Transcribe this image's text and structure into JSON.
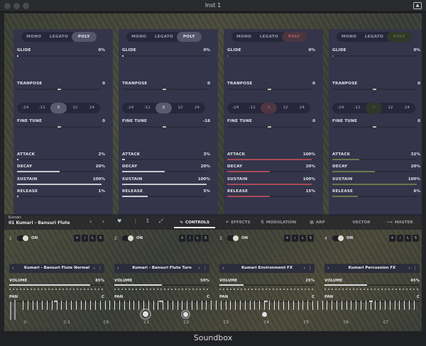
{
  "window": {
    "title": "Inst 1",
    "colors": {
      "panel": "#34354a",
      "accent_red": "#a84a55",
      "accent_green": "#6a7a4a"
    }
  },
  "panels": [
    {
      "modes": [
        "MONO",
        "LEGATO",
        "POLY"
      ],
      "active_mode": 2,
      "glide": {
        "label": "GLIDE",
        "value": "0%",
        "level": 0
      },
      "transpose": {
        "label": "TRANPOSE",
        "value": "0"
      },
      "semitones": [
        "-24",
        "-12",
        "0",
        "12",
        "24"
      ],
      "active_semitone": 2,
      "fine_tune": {
        "label": "FINE TUNE",
        "value": "0"
      },
      "attack": {
        "label": "ATTACK",
        "value": "2%",
        "level": 0.02
      },
      "decay": {
        "label": "DECAY",
        "value": "20%",
        "level": 0.5
      },
      "sustain": {
        "label": "SUSTAIN",
        "value": "100%",
        "level": 1.0
      },
      "release": {
        "label": "RELEASE",
        "value": "1%",
        "level": 0.01
      }
    },
    {
      "modes": [
        "MONO",
        "LEGATO",
        "POLY"
      ],
      "active_mode": 2,
      "glide": {
        "label": "GLIDE",
        "value": "0%",
        "level": 0
      },
      "transpose": {
        "label": "TRANPOSE",
        "value": "0"
      },
      "semitones": [
        "-24",
        "-12",
        "0",
        "12",
        "24"
      ],
      "active_semitone": 2,
      "fine_tune": {
        "label": "FINE TUNE",
        "value": "-18"
      },
      "attack": {
        "label": "ATTACK",
        "value": "3%",
        "level": 0.03
      },
      "decay": {
        "label": "DECAY",
        "value": "20%",
        "level": 0.5
      },
      "sustain": {
        "label": "SUSTAIN",
        "value": "100%",
        "level": 1.0
      },
      "release": {
        "label": "RELEASE",
        "value": "5%",
        "level": 0.3
      }
    },
    {
      "modes": [
        "MONO",
        "LEGATO",
        "POLY"
      ],
      "active_mode": 2,
      "glide": {
        "label": "GLIDE",
        "value": "0%",
        "level": 0
      },
      "transpose": {
        "label": "TRANPOSE",
        "value": "0"
      },
      "semitones": [
        "-24",
        "-12",
        "0",
        "12",
        "24"
      ],
      "active_semitone": 2,
      "fine_tune": {
        "label": "FINE TUNE",
        "value": "0"
      },
      "attack": {
        "label": "ATTACK",
        "value": "100%",
        "level": 1.0
      },
      "decay": {
        "label": "DECAY",
        "value": "20%",
        "level": 0.5
      },
      "sustain": {
        "label": "SUSTAIN",
        "value": "100%",
        "level": 1.0
      },
      "release": {
        "label": "RELEASE",
        "value": "15%",
        "level": 0.5
      }
    },
    {
      "modes": [
        "MONO",
        "LEGATO",
        "POLY"
      ],
      "active_mode": 2,
      "glide": {
        "label": "GLIDE",
        "value": "0%",
        "level": 0
      },
      "transpose": {
        "label": "TRANPOSE",
        "value": "0"
      },
      "semitones": [
        "-24",
        "-12",
        "0",
        "12",
        "24"
      ],
      "active_semitone": 2,
      "fine_tune": {
        "label": "FINE TUNE",
        "value": "0"
      },
      "attack": {
        "label": "ATTACK",
        "value": "32%",
        "level": 0.32
      },
      "decay": {
        "label": "DECAY",
        "value": "20%",
        "level": 0.5
      },
      "sustain": {
        "label": "SUSTAIN",
        "value": "100%",
        "level": 1.0
      },
      "release": {
        "label": "RELEASE",
        "value": "6%",
        "level": 0.3
      }
    }
  ],
  "preset": {
    "label": "Kumari",
    "name": "01 Kumari - Bansuri Flute"
  },
  "tabs": [
    "CONTROLS",
    "EFFECTS",
    "MODULATION",
    "ARP",
    "VECTOR",
    "MASTER"
  ],
  "active_tab": 0,
  "layers": [
    {
      "number": "1",
      "on_label": "ON",
      "buttons": [
        "L",
        "S"
      ],
      "preset": "Kumari - Bansuri Flute Normal",
      "volume": {
        "label": "VOLUME",
        "value": "85%",
        "level": 0.85
      },
      "pan": {
        "label": "PAN",
        "value": "C"
      }
    },
    {
      "number": "2",
      "on_label": "ON",
      "buttons": [
        "L",
        "S"
      ],
      "preset": "Kumari - Bansuri Flute Turn",
      "volume": {
        "label": "VOLUME",
        "value": "50%",
        "level": 0.5
      },
      "pan": {
        "label": "PAN",
        "value": "C"
      }
    },
    {
      "number": "3",
      "on_label": "ON",
      "buttons": [
        "L",
        "S"
      ],
      "preset": "Kumari Environment FX",
      "volume": {
        "label": "VOLUME",
        "value": "25%",
        "level": 0.25
      },
      "pan": {
        "label": "PAN",
        "value": "C"
      }
    },
    {
      "number": "4",
      "on_label": "ON",
      "buttons": [
        "L",
        "S"
      ],
      "preset": "Kumari Percussion FX",
      "volume": {
        "label": "VOLUME",
        "value": "45%",
        "level": 0.45
      },
      "pan": {
        "label": "PAN",
        "value": "C"
      }
    }
  ],
  "keyboard": {
    "octaves": [
      "C-",
      "C-1",
      "C0",
      "C1",
      "C2",
      "C3",
      "C4",
      "C5",
      "C6",
      "C7"
    ]
  },
  "footer": {
    "brand": "Soundbox"
  }
}
